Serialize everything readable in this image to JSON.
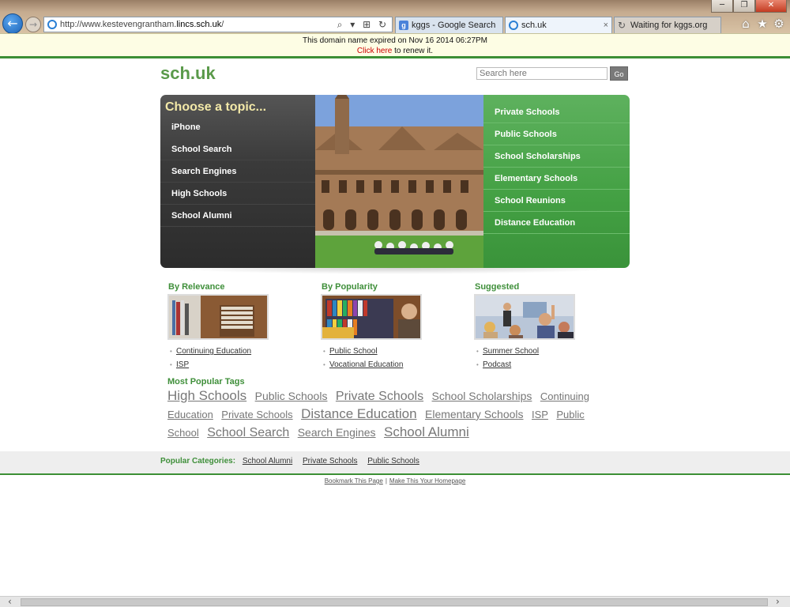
{
  "browser": {
    "url_prefix": "http://www.kestevengrantham.",
    "url_domain": "lincs.sch.uk",
    "url_suffix": "/",
    "address_tools": "⌕ ▾ ⊞ ↻",
    "tabs": [
      {
        "label": "kggs - Google Search",
        "icon": "g"
      },
      {
        "label": "sch.uk",
        "close": "×"
      },
      {
        "label": "Waiting for kggs.org"
      }
    ],
    "window_buttons": [
      "─",
      "❐",
      "✕"
    ],
    "toolbar_icons": [
      "⌂",
      "★",
      "⚙"
    ]
  },
  "notice": {
    "line1": "This domain name expired on Nov 16 2014 06:27PM",
    "link": "Click here",
    "line2_rest": " to renew it."
  },
  "site": {
    "logo": "sch.uk",
    "search_placeholder": "Search here",
    "go_label": "Go"
  },
  "hero": {
    "heading": "Choose a topic...",
    "left_items": [
      "iPhone",
      "School Search",
      "Search Engines",
      "High Schools",
      "School Alumni"
    ],
    "right_items": [
      "Private Schools",
      "Public Schools",
      "School Scholarships",
      "Elementary Schools",
      "School Reunions",
      "Distance Education"
    ]
  },
  "columns": [
    {
      "title": "By Relevance",
      "links": [
        "Continuing Education",
        "ISP"
      ]
    },
    {
      "title": "By Popularity",
      "links": [
        "Public School",
        "Vocational Education"
      ]
    },
    {
      "title": "Suggested",
      "links": [
        "Summer School",
        "Podcast"
      ]
    }
  ],
  "tags": {
    "title": "Most Popular Tags",
    "items": [
      {
        "label": "High Schools",
        "size": 4
      },
      {
        "label": "Public Schools",
        "size": 2
      },
      {
        "label": "Private Schools",
        "size": 3
      },
      {
        "label": "School Scholarships",
        "size": 2
      },
      {
        "label": "Continuing Education",
        "size": 1
      },
      {
        "label": "Private Schools",
        "size": 1
      },
      {
        "label": "Distance Education",
        "size": 4
      },
      {
        "label": "Elementary Schools",
        "size": 2
      },
      {
        "label": "ISP",
        "size": 1
      },
      {
        "label": "Public School",
        "size": 1
      },
      {
        "label": "School Search",
        "size": 3
      },
      {
        "label": "Search Engines",
        "size": 2
      },
      {
        "label": "School Alumni",
        "size": 4
      }
    ]
  },
  "popular": {
    "label": "Popular Categories:",
    "links": [
      "School Alumni",
      "Private Schools",
      "Public Schools"
    ]
  },
  "footer": {
    "links": [
      "Bookmark This Page",
      "Make This Your Homepage"
    ],
    "separator": "|"
  },
  "colors": {
    "accent_green": "#3f8f3a",
    "notice_link": "#cc0000"
  }
}
